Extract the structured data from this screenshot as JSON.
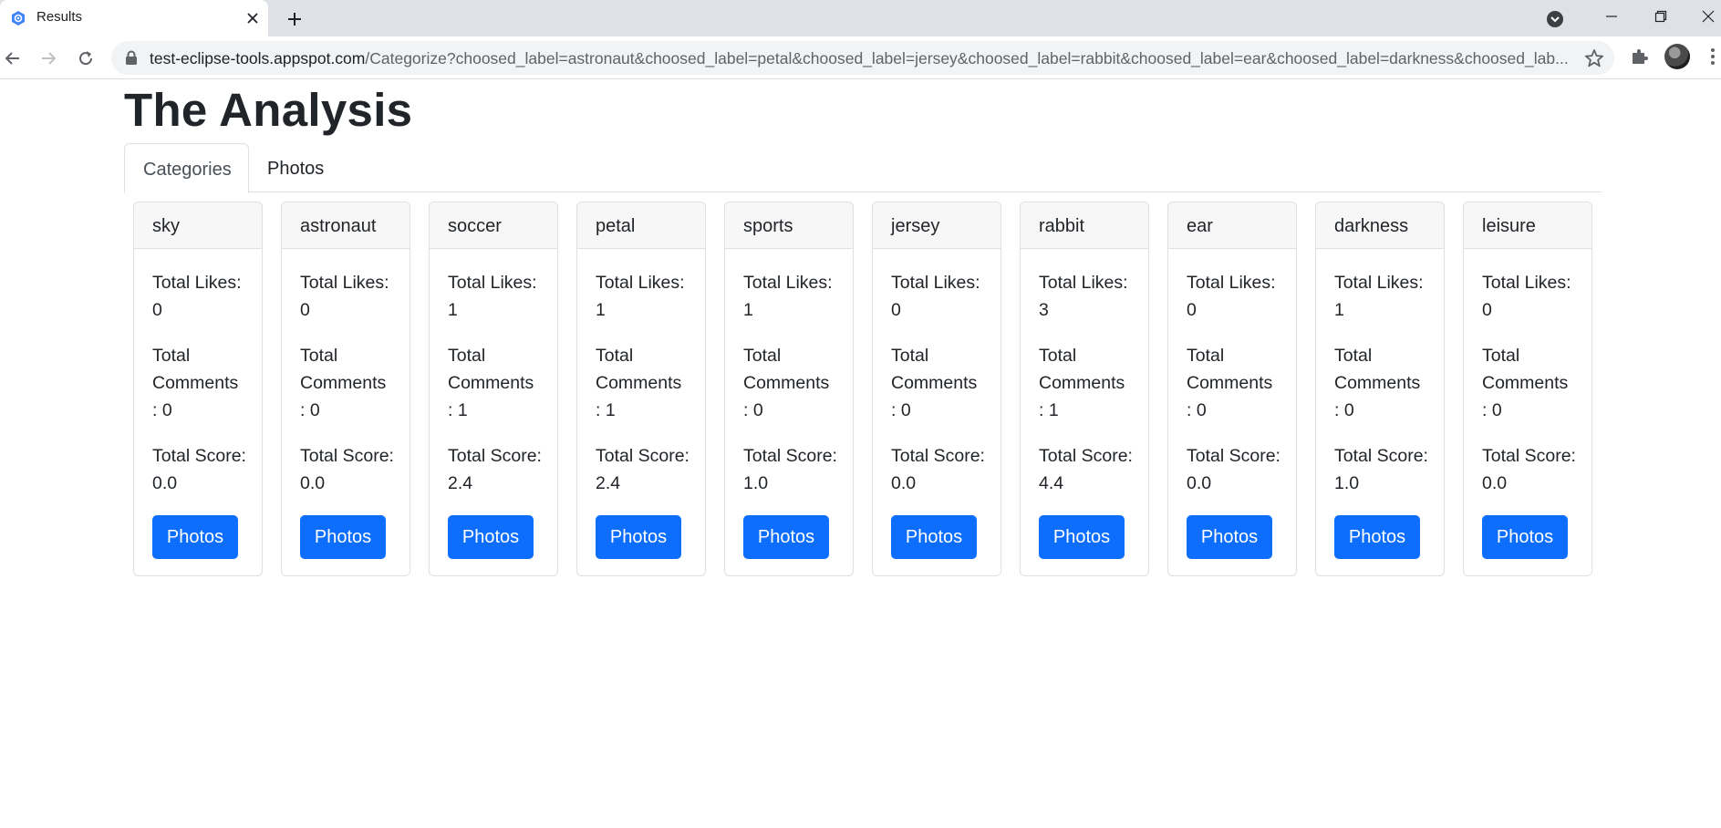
{
  "browser": {
    "tab_title": "Results",
    "url_host": "test-eclipse-tools.appspot.com",
    "url_path": "/Categorize?choosed_label=astronaut&choosed_label=petal&choosed_label=jersey&choosed_label=rabbit&choosed_label=ear&choosed_label=darkness&choosed_lab..."
  },
  "page": {
    "title": "The Analysis",
    "tabs": [
      {
        "label": "Categories",
        "active": true
      },
      {
        "label": "Photos",
        "active": false
      }
    ]
  },
  "labels": {
    "likes_prefix": "Total Likes:",
    "comments_prefix": "Total Comments",
    "score_prefix": "Total Score:",
    "button": "Photos"
  },
  "categories": [
    {
      "name": "sky",
      "likes": "0",
      "comments": "0",
      "score": "0.0"
    },
    {
      "name": "astronaut",
      "likes": "0",
      "comments": "0",
      "score": "0.0"
    },
    {
      "name": "soccer",
      "likes": "1",
      "comments": "1",
      "score": "2.4"
    },
    {
      "name": "petal",
      "likes": "1",
      "comments": "1",
      "score": "2.4"
    },
    {
      "name": "sports",
      "likes": "1",
      "comments": "0",
      "score": "1.0"
    },
    {
      "name": "jersey",
      "likes": "0",
      "comments": "0",
      "score": "0.0"
    },
    {
      "name": "rabbit",
      "likes": "3",
      "comments": "1",
      "score": "4.4"
    },
    {
      "name": "ear",
      "likes": "0",
      "comments": "0",
      "score": "0.0"
    },
    {
      "name": "darkness",
      "likes": "1",
      "comments": "0",
      "score": "1.0"
    },
    {
      "name": "leisure",
      "likes": "0",
      "comments": "0",
      "score": "0.0"
    }
  ],
  "colors": {
    "primary": "#0d6efd",
    "card_header_bg": "#f7f7f7",
    "tabstrip_bg": "#dee1e6"
  }
}
